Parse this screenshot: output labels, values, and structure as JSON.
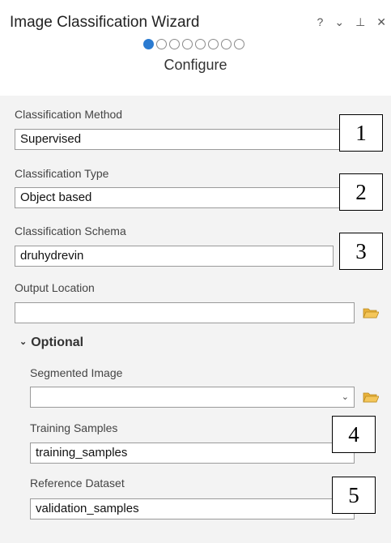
{
  "window": {
    "title": "Image Classification Wizard",
    "controls": [
      "?",
      "⌄",
      "⊥",
      "✕"
    ]
  },
  "wizard": {
    "total_steps": 8,
    "current_step": 1,
    "step_label": "Configure"
  },
  "form": {
    "classification_method": {
      "label": "Classification Method",
      "value": "Supervised"
    },
    "classification_type": {
      "label": "Classification Type",
      "value": "Object based"
    },
    "classification_schema": {
      "label": "Classification Schema",
      "value": "druhydrevin"
    },
    "output_location": {
      "label": "Output Location",
      "value": ""
    },
    "optional_header": "Optional",
    "segmented_image": {
      "label": "Segmented Image",
      "value": ""
    },
    "training_samples": {
      "label": "Training Samples",
      "value": "training_samples"
    },
    "reference_dataset": {
      "label": "Reference Dataset",
      "value": "validation_samples"
    }
  },
  "callouts": [
    "1",
    "2",
    "3",
    "4",
    "5"
  ],
  "colors": {
    "accent": "#2b7bd1",
    "folder": "#e8b13a"
  },
  "icons": {
    "folder": "folder-icon",
    "dropdown": "chevron-down-icon"
  }
}
